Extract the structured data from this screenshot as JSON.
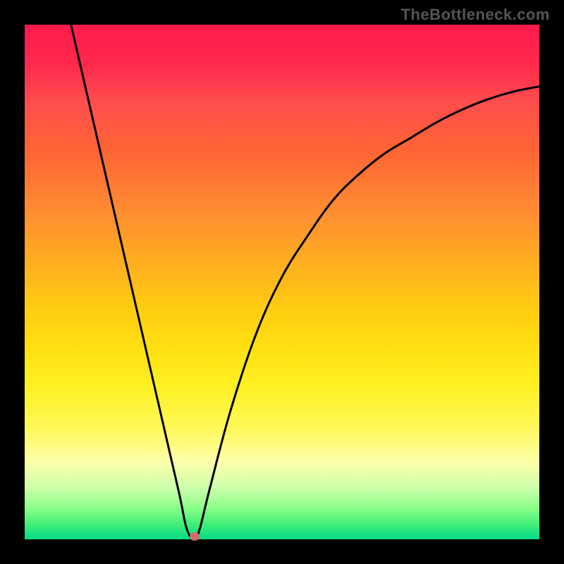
{
  "watermark": "TheBottleneck.com",
  "chart_data": {
    "type": "line",
    "title": "",
    "xlabel": "",
    "ylabel": "",
    "xlim": [
      0,
      100
    ],
    "ylim": [
      0,
      100
    ],
    "grid": false,
    "legend": false,
    "series": [
      {
        "name": "bottleneck-curve",
        "x": [
          9,
          12,
          15,
          18,
          21,
          24,
          27,
          30,
          31.5,
          33,
          34,
          36,
          40,
          45,
          50,
          55,
          60,
          65,
          70,
          75,
          80,
          85,
          90,
          95,
          100
        ],
        "y": [
          100,
          87,
          74,
          61,
          48,
          35,
          22,
          9,
          2,
          0,
          2,
          10,
          25,
          40,
          51,
          59,
          66,
          71,
          75,
          78,
          81,
          83.5,
          85.5,
          87,
          88
        ]
      }
    ],
    "marker": {
      "x": 33,
      "y": 0.5,
      "color": "#d46a6a"
    },
    "background_gradient": {
      "top": "#ff1a4d",
      "mid": "#ffe011",
      "bottom": "#00dd88"
    }
  }
}
